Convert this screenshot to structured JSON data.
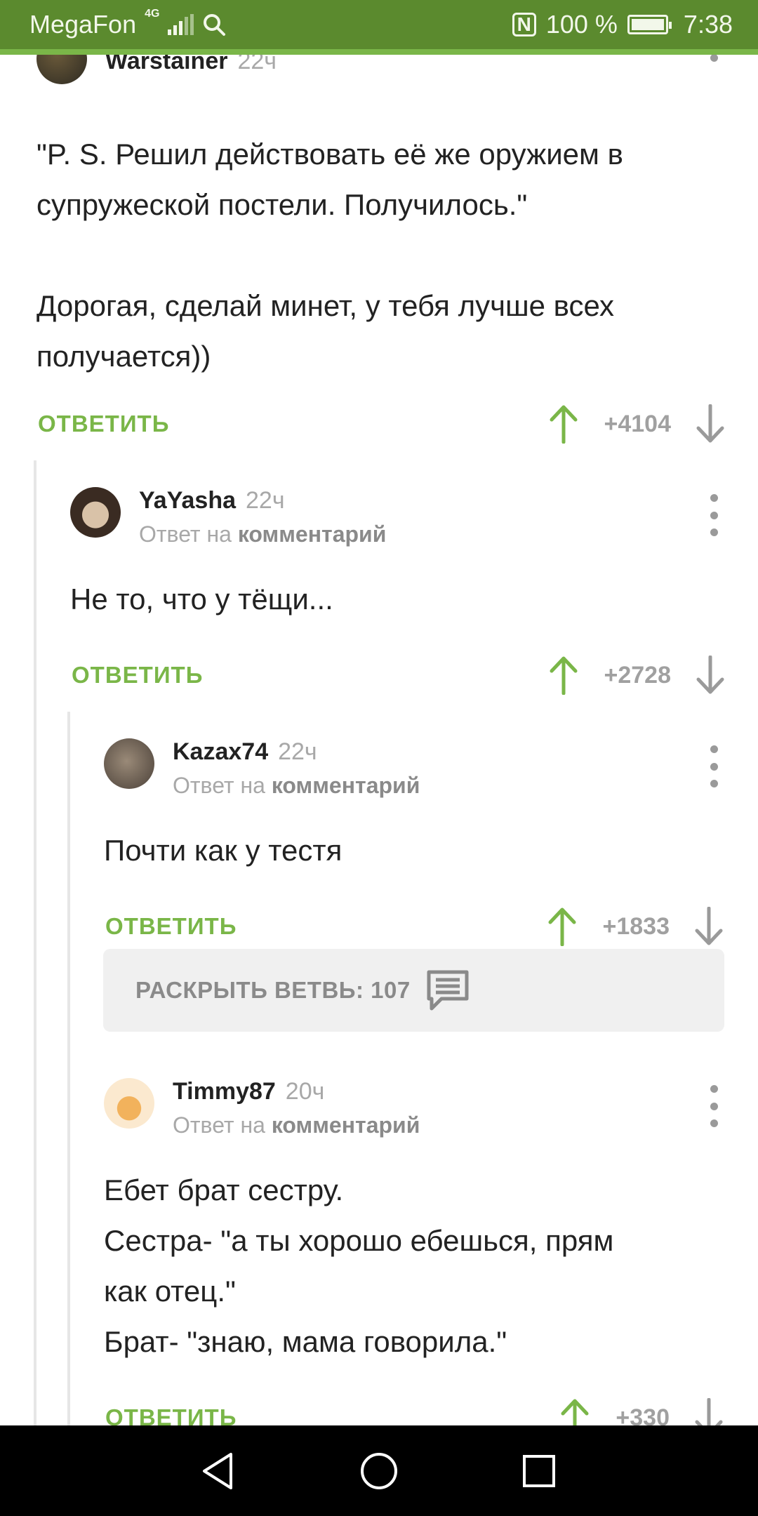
{
  "status_bar": {
    "carrier": "MegaFon",
    "network": "4G",
    "battery": "100 %",
    "time": "7:38",
    "icons": [
      "signal-icon",
      "search-icon",
      "nfc-icon",
      "battery-icon"
    ]
  },
  "comments": [
    {
      "user": "Warstainer",
      "time": "22ч",
      "text_lines": [
        "\"P. S. Решил действовать её же оружием в",
        "супружеской постели. Получилось.\"",
        "",
        "Дорогая, сделай минет, у тебя лучше всех",
        "получается))"
      ],
      "reply_label": "ОТВЕТИТЬ",
      "score": "+4104"
    },
    {
      "user": "YaYasha",
      "time": "22ч",
      "reply_to_prefix": "Ответ на",
      "reply_to_link": "комментарий",
      "text_lines": [
        "Не то, что у тёщи..."
      ],
      "reply_label": "ОТВЕТИТЬ",
      "score": "+2728"
    },
    {
      "user": "Kazax74",
      "time": "22ч",
      "reply_to_prefix": "Ответ на",
      "reply_to_link": "комментарий",
      "text_lines": [
        "Почти как у тестя"
      ],
      "reply_label": "ОТВЕТИТЬ",
      "score": "+1833"
    },
    {
      "user": "Timmy87",
      "time": "20ч",
      "reply_to_prefix": "Ответ на",
      "reply_to_link": "комментарий",
      "text_lines": [
        "Ебет брат сестру.",
        "Сестра- \"а ты хорошо ебешься, прям",
        "как отец.\"",
        "Брат- \"знаю, мама говорила.\""
      ],
      "reply_label": "ОТВЕТИТЬ",
      "score": "+330"
    }
  ],
  "expand_branch": {
    "label": "РАСКРЫТЬ ВЕТВЬ: 107",
    "icon": "comments-icon"
  },
  "colors": {
    "status_bar": "#5b8a2e",
    "accent_green": "#7ab648",
    "muted": "#a0a0a0"
  }
}
